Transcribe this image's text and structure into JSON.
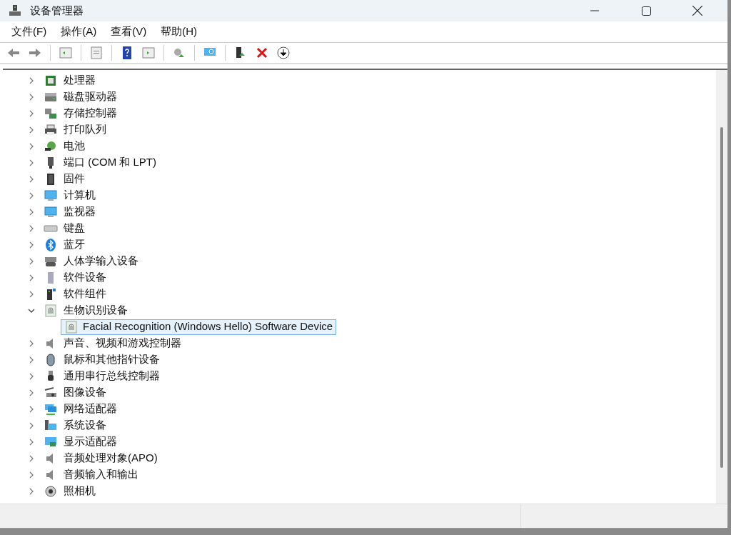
{
  "window": {
    "title": "设备管理器"
  },
  "menu": [
    "文件(F)",
    "操作(A)",
    "查看(V)",
    "帮助(H)"
  ],
  "tree": [
    {
      "label": "处理器",
      "expanded": false
    },
    {
      "label": "磁盘驱动器",
      "expanded": false
    },
    {
      "label": "存储控制器",
      "expanded": false
    },
    {
      "label": "打印队列",
      "expanded": false
    },
    {
      "label": "电池",
      "expanded": false
    },
    {
      "label": "端口 (COM 和 LPT)",
      "expanded": false
    },
    {
      "label": "固件",
      "expanded": false
    },
    {
      "label": "计算机",
      "expanded": false
    },
    {
      "label": "监视器",
      "expanded": false
    },
    {
      "label": "键盘",
      "expanded": false
    },
    {
      "label": "蓝牙",
      "expanded": false
    },
    {
      "label": "人体学输入设备",
      "expanded": false
    },
    {
      "label": "软件设备",
      "expanded": false
    },
    {
      "label": "软件组件",
      "expanded": false
    },
    {
      "label": "生物识别设备",
      "expanded": true,
      "children": [
        {
          "label": "Facial Recognition (Windows Hello) Software Device",
          "selected": true
        }
      ]
    },
    {
      "label": "声音、视频和游戏控制器",
      "expanded": false
    },
    {
      "label": "鼠标和其他指针设备",
      "expanded": false
    },
    {
      "label": "通用串行总线控制器",
      "expanded": false
    },
    {
      "label": "图像设备",
      "expanded": false
    },
    {
      "label": "网络适配器",
      "expanded": false
    },
    {
      "label": "系统设备",
      "expanded": false
    },
    {
      "label": "显示适配器",
      "expanded": false
    },
    {
      "label": "音频处理对象(APO)",
      "expanded": false
    },
    {
      "label": "音频输入和输出",
      "expanded": false
    },
    {
      "label": "照相机",
      "expanded": false
    }
  ]
}
